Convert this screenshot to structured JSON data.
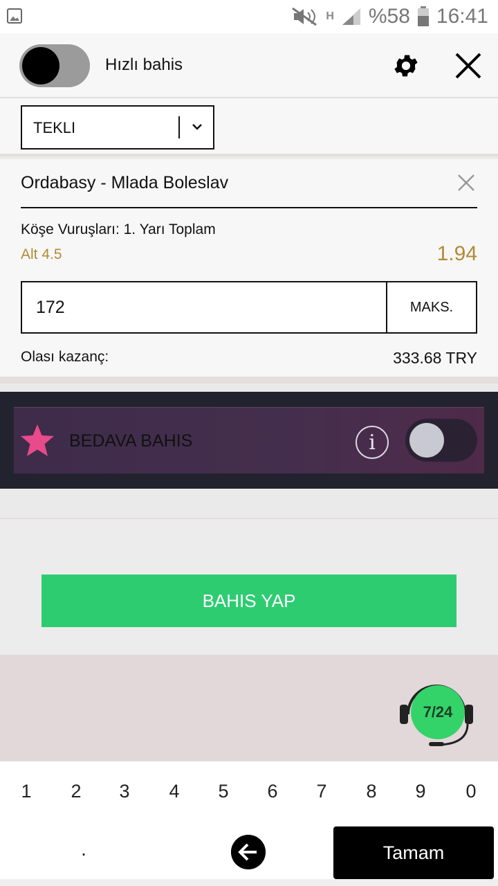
{
  "status_bar": {
    "battery": "%58",
    "time": "16:41",
    "network": "H"
  },
  "header": {
    "quick_bet_label": "Hızlı bahis",
    "quick_bet_enabled": false
  },
  "bet_type": {
    "selected": "TEKLI"
  },
  "bet": {
    "match": "Ordabasy - Mlada Boleslav",
    "market": "Köşe Vuruşları: 1. Yarı Toplam",
    "selection": "Alt 4.5",
    "odds": "1.94",
    "stake": "172",
    "max_label": "MAKS.",
    "potential_win_label": "Olası kazanç:",
    "potential_win_value": "333.68 TRY"
  },
  "free_bet": {
    "label": "BEDAVA BAHIS",
    "enabled": false
  },
  "place_bet": {
    "label": "BAHIS YAP"
  },
  "support": {
    "badge": "7/24"
  },
  "keypad": {
    "digits": [
      "1",
      "2",
      "3",
      "4",
      "5",
      "6",
      "7",
      "8",
      "9",
      "0"
    ],
    "dot": ".",
    "done": "Tamam"
  },
  "colors": {
    "accent_green": "#2ecc71",
    "odds_gold": "#b28a34",
    "star_pink": "#e84a8a"
  }
}
